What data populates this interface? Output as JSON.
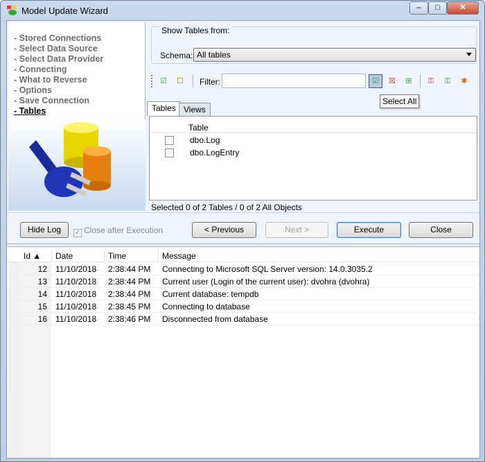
{
  "window": {
    "title": "Model Update Wizard",
    "min": "‒",
    "max": "□",
    "close": "✕"
  },
  "steps": [
    "- Stored Connections",
    "- Select Data Source",
    "- Select Data Provider",
    "- Connecting",
    "- What to Reverse",
    "- Options",
    "- Save Connection",
    "- Tables"
  ],
  "current_step": 7,
  "show_tables": {
    "group_label": "Show Tables from:",
    "schema_label": "Schema:",
    "schema_value": "All tables"
  },
  "toolbar": {
    "filter_label": "Filter:",
    "filter_value": "",
    "tooltip": "Select All"
  },
  "tabs": [
    "Tables",
    "Views"
  ],
  "grid": {
    "header": "Table",
    "rows": [
      {
        "name": "dbo.Log",
        "checked": false
      },
      {
        "name": "dbo.LogEntry",
        "checked": false
      }
    ]
  },
  "status": "Selected 0 of 2 Tables / 0 of 2 All Objects",
  "buttons": {
    "hide_log": "Hide Log",
    "close_after": "Close after Execution",
    "close_after_checked": true,
    "previous": "< Previous",
    "next": "Next >",
    "execute": "Execute",
    "close": "Close"
  },
  "log": {
    "headers": [
      "Id ▲",
      "Date",
      "Time",
      "Message"
    ],
    "rows": [
      [
        "12",
        "11/10/2018",
        "2:38:44 PM",
        "Connecting to Microsoft SQL Server version: 14.0.3035.2"
      ],
      [
        "13",
        "11/10/2018",
        "2:38:44 PM",
        "Current user (Login of the current user): dvohra (dvohra)"
      ],
      [
        "14",
        "11/10/2018",
        "2:38:44 PM",
        "Current database: tempdb"
      ],
      [
        "15",
        "11/10/2018",
        "2:38:45 PM",
        "Connecting to database"
      ],
      [
        "16",
        "11/10/2018",
        "2:38:46 PM",
        "Disconnected from database"
      ]
    ]
  }
}
